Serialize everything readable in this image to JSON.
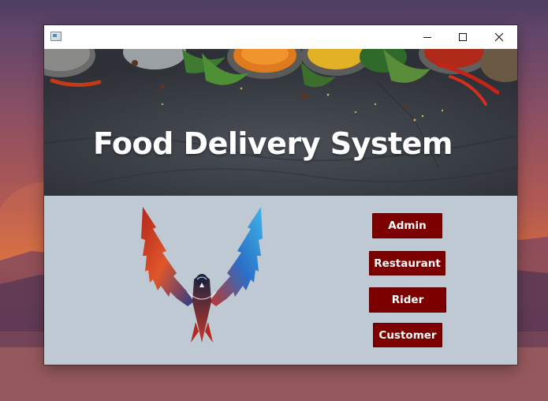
{
  "window": {
    "title": "",
    "controls": {
      "minimize_icon": "minimize-icon",
      "maximize_icon": "maximize-icon",
      "close_icon": "close-icon"
    }
  },
  "banner": {
    "title": "Food Delivery System"
  },
  "logo": {
    "icon": "phoenix-logo"
  },
  "menu": {
    "admin_label": "Admin",
    "restaurant_label": "Restaurant",
    "rider_label": "Rider",
    "customer_label": "Customer"
  },
  "colors": {
    "button_bg": "#7d0000",
    "panel_bg": "#bfc9d4",
    "banner_bg": "#3a3e45"
  }
}
